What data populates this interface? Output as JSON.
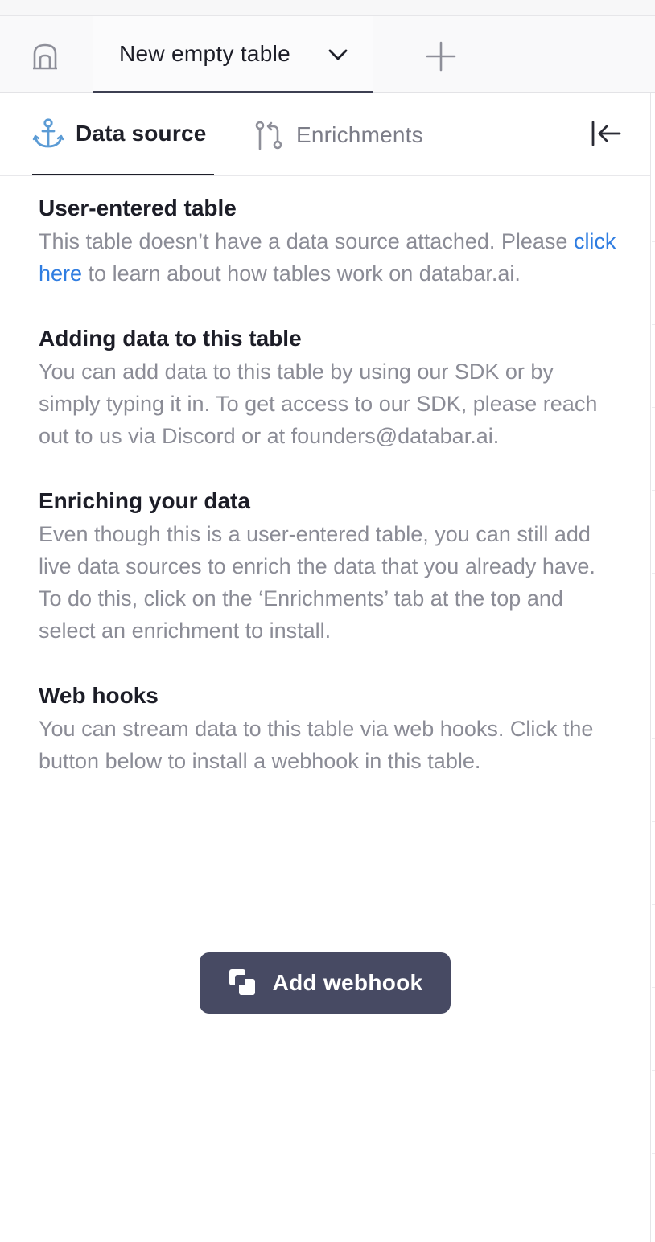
{
  "tabbar": {
    "home_icon": "home-icon",
    "table_tab_label": "New empty table",
    "chevron_icon": "chevron-down-icon",
    "add_tab_icon": "plus-icon"
  },
  "panel": {
    "tabs": [
      {
        "label": "Data source",
        "icon": "anchor-icon",
        "active": true
      },
      {
        "label": "Enrichments",
        "icon": "git-pull-request-icon",
        "active": false
      }
    ],
    "collapse_icon": "collapse-left-icon"
  },
  "sections": {
    "user_entered": {
      "title": "User-entered table",
      "body_before_link": "This table doesn’t have a data source attached. Please ",
      "link": "click here",
      "body_after_link": " to learn about how tables work on databar.ai."
    },
    "adding_data": {
      "title": "Adding data to this table",
      "body": "You can add data to this table by using our SDK or by simply typing it in. To get access to our SDK, please reach out to us via Discord or at founders@databar.ai."
    },
    "enriching": {
      "title": "Enriching your data",
      "body": "Even though this is a user-entered table, you can still add live data sources to enrich the data that you already have. To do this, click on the ‘Enrichments’ tab at the top and select an enrichment to install."
    },
    "webhooks": {
      "title": "Web hooks",
      "body": "You can stream data to this table via web hooks. Click the button below to install a webhook in this table."
    }
  },
  "webhook_button": {
    "label": "Add webhook",
    "icon": "webhook-stack-icon"
  },
  "colors": {
    "accent_link": "#2f7de1",
    "button_bg": "#474a63",
    "anchor_icon": "#5b9bd5",
    "text_dark": "#1c1d27",
    "text_muted": "#8b8c96"
  }
}
